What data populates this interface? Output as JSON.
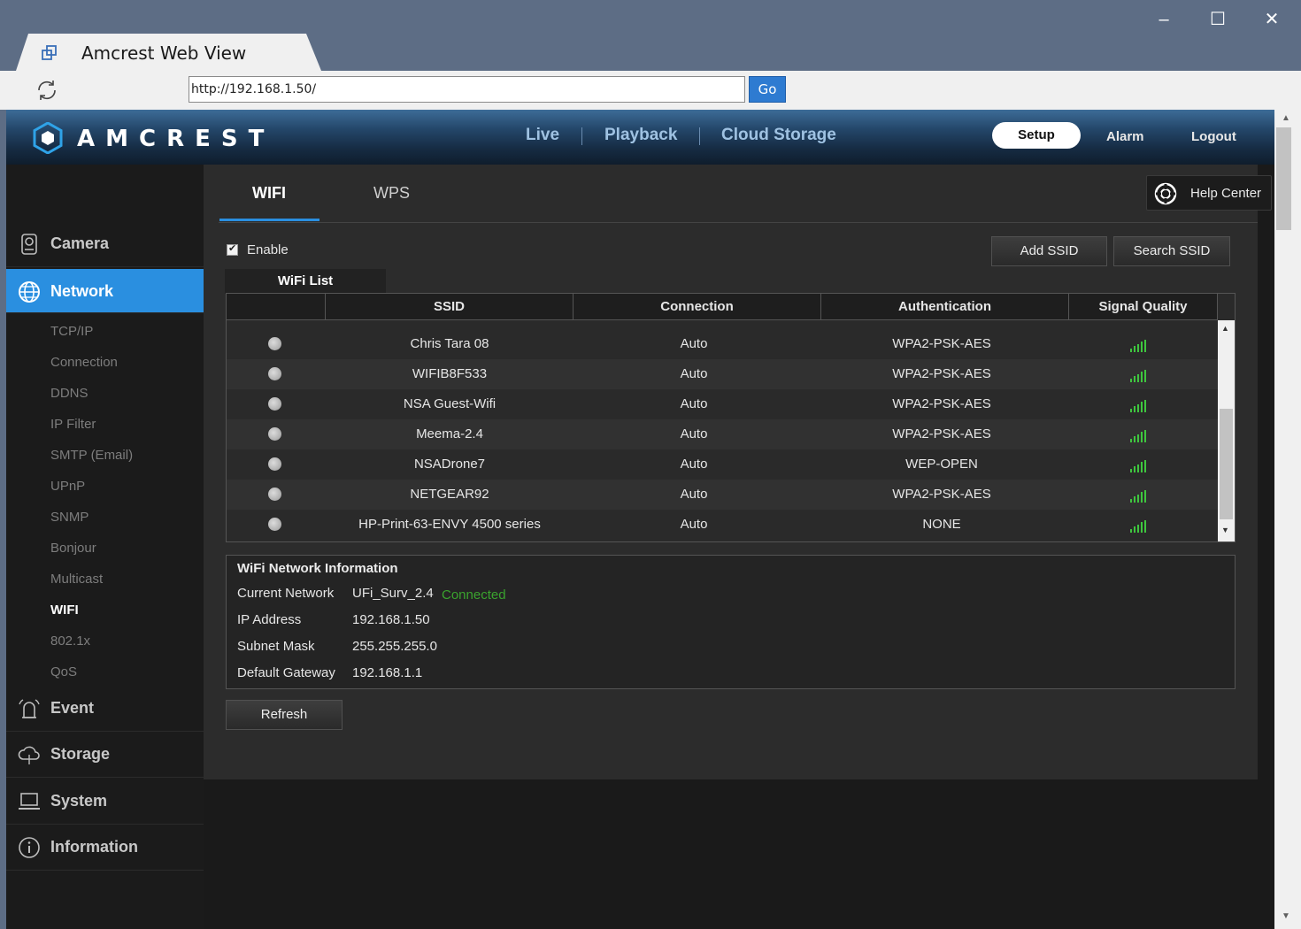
{
  "window": {
    "tab_title": "Amcrest Web View",
    "url": "http://192.168.1.50/",
    "go_label": "Go",
    "minimize": "–",
    "maximize": "☐",
    "close": "✕"
  },
  "header": {
    "brand": "AMCREST",
    "nav": [
      "Live",
      "Playback",
      "Cloud Storage"
    ],
    "setup": "Setup",
    "alarm": "Alarm",
    "logout": "Logout"
  },
  "sidebar": {
    "camera": "Camera",
    "network": "Network",
    "network_items": [
      "TCP/IP",
      "Connection",
      "DDNS",
      "IP Filter",
      "SMTP (Email)",
      "UPnP",
      "SNMP",
      "Bonjour",
      "Multicast",
      "WIFI",
      "802.1x",
      "QoS"
    ],
    "active_sub": "WIFI",
    "event": "Event",
    "storage": "Storage",
    "system": "System",
    "information": "Information"
  },
  "content": {
    "tabs": [
      "WIFI",
      "WPS"
    ],
    "help_center": "Help Center",
    "enable_label": "Enable",
    "enable_checked": true,
    "add_ssid": "Add SSID",
    "search_ssid": "Search SSID",
    "wifi_list_tab": "WiFi List",
    "columns": [
      "",
      "SSID",
      "Connection",
      "Authentication",
      "Signal Quality"
    ],
    "rows": [
      {
        "ssid": "Chris Tara 08",
        "connection": "Auto",
        "auth": "WPA2-PSK-AES"
      },
      {
        "ssid": "WIFIB8F533",
        "connection": "Auto",
        "auth": "WPA2-PSK-AES"
      },
      {
        "ssid": "NSA Guest-Wifi",
        "connection": "Auto",
        "auth": "WPA2-PSK-AES"
      },
      {
        "ssid": "Meema-2.4",
        "connection": "Auto",
        "auth": "WPA2-PSK-AES"
      },
      {
        "ssid": "NSADrone7",
        "connection": "Auto",
        "auth": "WEP-OPEN"
      },
      {
        "ssid": "NETGEAR92",
        "connection": "Auto",
        "auth": "WPA2-PSK-AES"
      },
      {
        "ssid": "HP-Print-63-ENVY 4500 series",
        "connection": "Auto",
        "auth": "NONE"
      }
    ],
    "info": {
      "title": "WiFi Network Information",
      "current_network_label": "Current Network",
      "current_network": "UFi_Surv_2.4",
      "status": "Connected",
      "ip_label": "IP Address",
      "ip": "192.168.1.50",
      "subnet_label": "Subnet Mask",
      "subnet": "255.255.255.0",
      "gateway_label": "Default Gateway",
      "gateway": "192.168.1.1"
    },
    "refresh": "Refresh"
  },
  "colors": {
    "accent": "#2a8fe0",
    "connected": "#3aa32e",
    "signal": "#3ec63e"
  }
}
